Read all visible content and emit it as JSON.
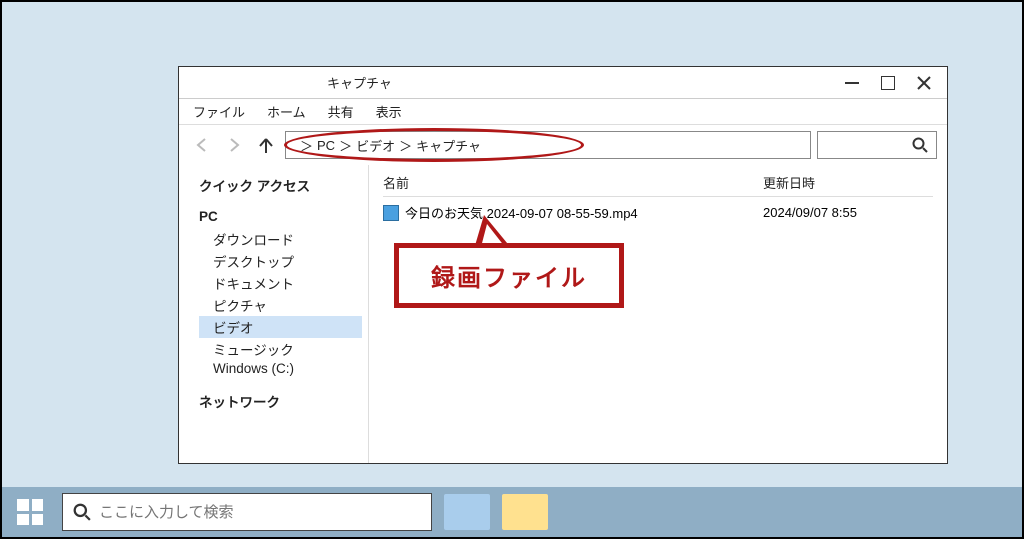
{
  "explorer": {
    "title": "キャプチャ",
    "menu": {
      "file": "ファイル",
      "home": "ホーム",
      "share": "共有",
      "view": "表示"
    },
    "breadcrumb": {
      "sep1": "＞",
      "pc": "PC",
      "sep2": "＞",
      "video": "ビデオ",
      "sep3": "＞",
      "cap": "キャプチャ"
    },
    "columns": {
      "name": "名前",
      "date": "更新日時"
    },
    "file": {
      "name": "今日のお天気 2024-09-07 08-55-59.mp4",
      "date": "2024/09/07 8:55"
    }
  },
  "sidebar": {
    "quick_access": "クイック アクセス",
    "pc": "PC",
    "downloads": "ダウンロード",
    "desktop": "デスクトップ",
    "documents": "ドキュメント",
    "pictures": "ピクチャ",
    "videos": "ビデオ",
    "music": "ミュージック",
    "cdrive": "Windows (C:)",
    "network": "ネットワーク"
  },
  "callout": {
    "label": "録画ファイル"
  },
  "taskbar": {
    "search_placeholder": "ここに入力して検索"
  }
}
